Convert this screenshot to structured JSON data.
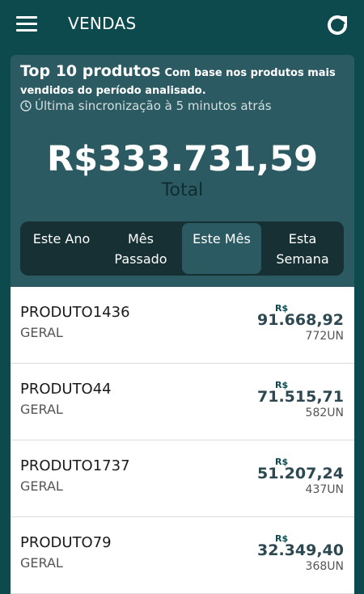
{
  "header": {
    "title": "VENDAS",
    "menu_icon": "hamburger-menu-icon",
    "refresh_icon": "refresh-icon"
  },
  "summary": {
    "heading": "Top 10 produtos",
    "subheading": "Com base nos produtos mais vendidos do período analisado.",
    "sync_text": "Última sincronização à 5 minutos atrás",
    "total_value": "R$333.731,59",
    "total_label": "Total"
  },
  "periods": [
    {
      "label": "Este Ano",
      "active": false
    },
    {
      "label": "Mês Passado",
      "active": false
    },
    {
      "label": "Este Mês",
      "active": true
    },
    {
      "label": "Esta Semana",
      "active": false
    }
  ],
  "products": [
    {
      "name": "PRODUTO1436",
      "category": "GERAL",
      "currency": "R$",
      "amount": "91.668,92",
      "units": "772UN"
    },
    {
      "name": "PRODUTO44",
      "category": "GERAL",
      "currency": "R$",
      "amount": "71.515,71",
      "units": "582UN"
    },
    {
      "name": "PRODUTO1737",
      "category": "GERAL",
      "currency": "R$",
      "amount": "51.207,24",
      "units": "437UN"
    },
    {
      "name": "PRODUTO79",
      "category": "GERAL",
      "currency": "R$",
      "amount": "32.349,40",
      "units": "368UN"
    }
  ],
  "colors": {
    "background": "#0d4a4d",
    "card": "#2c5a62",
    "segment_bg": "#163034"
  }
}
